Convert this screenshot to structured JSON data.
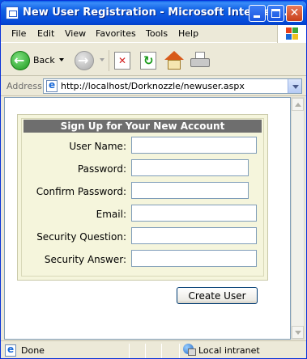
{
  "window": {
    "title": "New User Registration - Microsoft Internet..."
  },
  "menu": {
    "items": [
      "File",
      "Edit",
      "View",
      "Favorites",
      "Tools",
      "Help"
    ]
  },
  "toolbar": {
    "back_label": "Back"
  },
  "address": {
    "label": "Address",
    "url": "http://localhost/Dorknozzle/newuser.aspx"
  },
  "form": {
    "header": "Sign Up for Your New Account",
    "fields": [
      {
        "label": "User Name:",
        "value": ""
      },
      {
        "label": "Password:",
        "value": ""
      },
      {
        "label": "Confirm Password:",
        "value": ""
      },
      {
        "label": "Email:",
        "value": ""
      },
      {
        "label": "Security Question:",
        "value": ""
      },
      {
        "label": "Security Answer:",
        "value": ""
      }
    ],
    "submit_label": "Create User"
  },
  "status": {
    "text": "Done",
    "zone": "Local intranet"
  },
  "colors": {
    "titlebar": "#0054e3",
    "form_background": "#f5f5dc",
    "form_header": "#6e6e6e"
  }
}
